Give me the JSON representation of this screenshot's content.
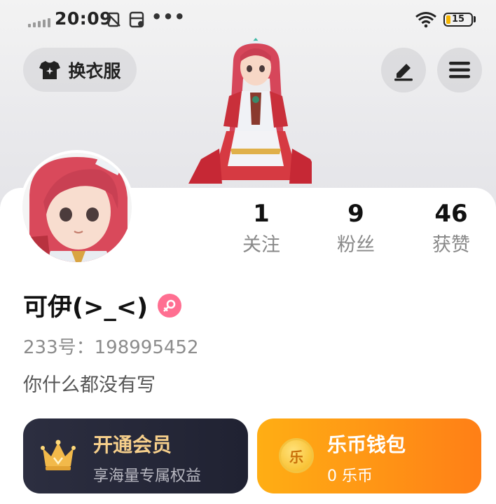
{
  "status_bar": {
    "time": "20:09",
    "battery_level": "15"
  },
  "header": {
    "dress_up_label": "换衣服"
  },
  "profile": {
    "username": "可伊(>_<)",
    "account_id": "233号：198995452",
    "bio": "你什么都没有写",
    "stats": [
      {
        "value": "1",
        "label": "关注"
      },
      {
        "value": "9",
        "label": "粉丝"
      },
      {
        "value": "46",
        "label": "获赞"
      }
    ]
  },
  "cards": {
    "vip": {
      "title": "开通会员",
      "subtitle": "享海量专属权益"
    },
    "wallet": {
      "title": "乐币钱包",
      "subtitle": "0 乐币",
      "coin_glyph": "乐"
    }
  },
  "colors": {
    "vip_title": "#f6cf8b",
    "wallet_gradient_start": "#ffae14",
    "wallet_gradient_end": "#ff7f16",
    "gender_badge": "#ff6f91"
  }
}
